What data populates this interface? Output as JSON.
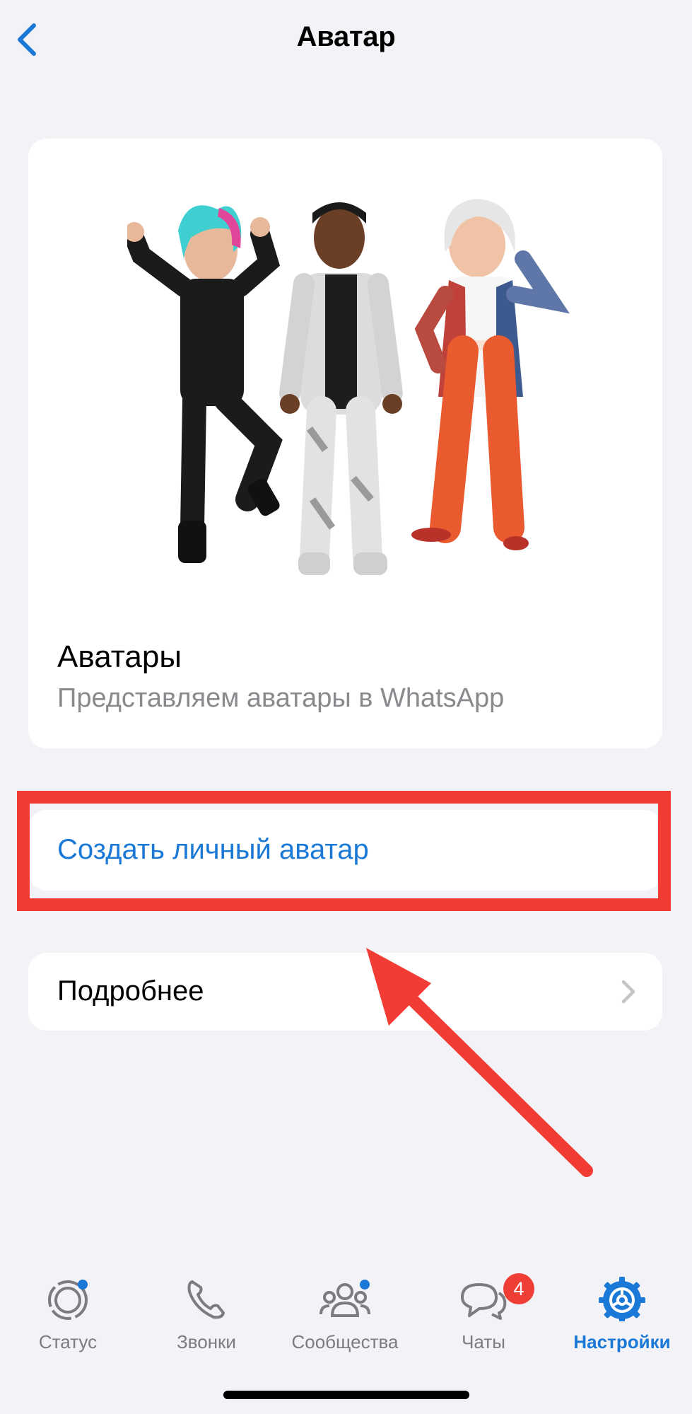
{
  "header": {
    "title": "Аватар",
    "back_icon": "chevron-left-icon"
  },
  "hero": {
    "title": "Аватары",
    "subtitle": "Представляем аватары в WhatsApp"
  },
  "create": {
    "label": "Создать личный аватар"
  },
  "more": {
    "label": "Подробнее",
    "icon": "chevron-right-icon"
  },
  "tabbar": {
    "tabs": [
      {
        "label": "Статус",
        "icon": "status-icon"
      },
      {
        "label": "Звонки",
        "icon": "phone-icon"
      },
      {
        "label": "Сообщества",
        "icon": "communities-icon"
      },
      {
        "label": "Чаты",
        "icon": "chats-icon",
        "badge": "4"
      },
      {
        "label": "Настройки",
        "icon": "settings-icon",
        "active": true
      }
    ]
  },
  "colors": {
    "accent": "#1a78d6",
    "annotation": "#f23c33",
    "badge": "#ee3e36",
    "background": "#f2f2f7"
  }
}
